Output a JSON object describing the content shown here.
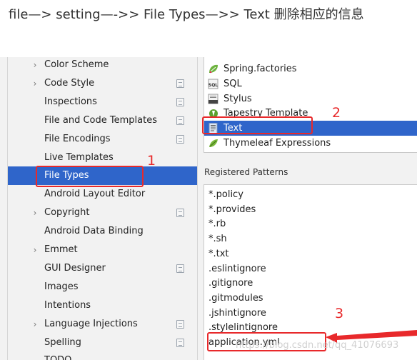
{
  "caption": "file—> setting—->> File Types—>> Text 删除相应的信息",
  "left_tree": {
    "items": [
      {
        "label": "Color Scheme",
        "expandable": true,
        "project": false
      },
      {
        "label": "Code Style",
        "expandable": true,
        "project": true
      },
      {
        "label": "Inspections",
        "expandable": false,
        "project": true
      },
      {
        "label": "File and Code Templates",
        "expandable": false,
        "project": true
      },
      {
        "label": "File Encodings",
        "expandable": false,
        "project": true
      },
      {
        "label": "Live Templates",
        "expandable": false,
        "project": false
      },
      {
        "label": "File Types",
        "expandable": false,
        "project": false,
        "selected": true
      },
      {
        "label": "Android Layout Editor",
        "expandable": false,
        "project": false
      },
      {
        "label": "Copyright",
        "expandable": true,
        "project": true
      },
      {
        "label": "Android Data Binding",
        "expandable": false,
        "project": false
      },
      {
        "label": "Emmet",
        "expandable": true,
        "project": false
      },
      {
        "label": "GUI Designer",
        "expandable": false,
        "project": true
      },
      {
        "label": "Images",
        "expandable": false,
        "project": false
      },
      {
        "label": "Intentions",
        "expandable": false,
        "project": false
      },
      {
        "label": "Language Injections",
        "expandable": true,
        "project": true
      },
      {
        "label": "Spelling",
        "expandable": false,
        "project": true
      },
      {
        "label": "TODO",
        "expandable": false,
        "project": false
      }
    ]
  },
  "file_types": {
    "items": [
      {
        "label": "Spring.factories",
        "icon": "spring-leaf-icon"
      },
      {
        "label": "SQL",
        "icon": "sql-file-icon"
      },
      {
        "label": "Stylus",
        "icon": "stylus-file-icon"
      },
      {
        "label": "Tapestry Template",
        "icon": "tapestry-icon"
      },
      {
        "label": "Text",
        "icon": "text-file-icon",
        "selected": true
      },
      {
        "label": "Thymeleaf Expressions",
        "icon": "thymeleaf-icon"
      }
    ]
  },
  "registered_patterns": {
    "label": "Registered Patterns",
    "items": [
      "*.policy",
      "*.provides",
      "*.rb",
      "*.sh",
      "*.txt",
      ".eslintignore",
      ".gitignore",
      ".gitmodules",
      ".jshintignore",
      ".stylelintignore",
      "application.yml"
    ]
  },
  "annotations": {
    "step1": "1",
    "step2": "2",
    "step3": "3",
    "color": "#e8292b"
  },
  "watermark": "https://blog.csdn.net/qq_41076693",
  "colors": {
    "selection": "#2f65ca",
    "panel": "#f2f2f2"
  }
}
